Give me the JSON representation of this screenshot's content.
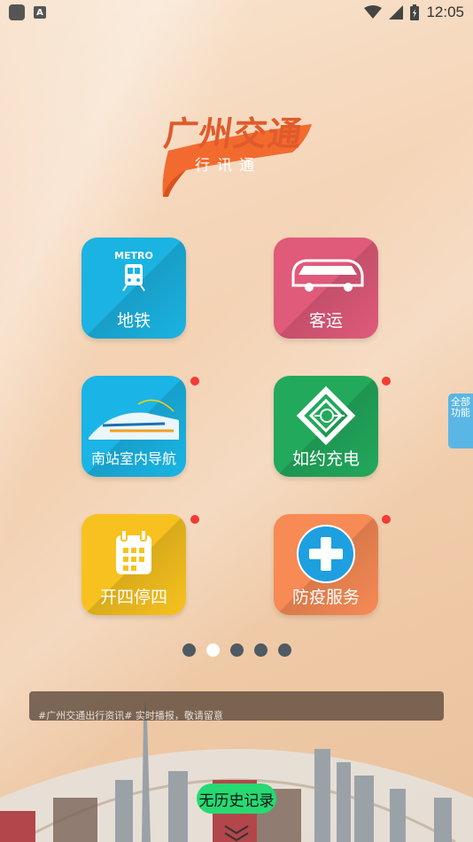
{
  "status_bar": {
    "time": "12:05",
    "left_icons": [
      "app-square-icon",
      "text-a-icon"
    ],
    "right_icons": [
      "wifi-icon",
      "signal-icon",
      "battery-icon"
    ]
  },
  "logo": {
    "title": "广州交通",
    "subtitle": "行讯通"
  },
  "apps": [
    {
      "label": "地铁",
      "icon": "metro-train-icon",
      "metro_text": "METRO",
      "color": "#1bb3e2",
      "badge": false
    },
    {
      "label": "客运",
      "icon": "bus-icon",
      "color": "#e05a7a",
      "badge": false
    },
    {
      "label": "南站室内导航",
      "icon": "high-speed-train-icon",
      "color": "#1ab5e6",
      "badge": true
    },
    {
      "label": "如约充电",
      "icon": "charging-plug-icon",
      "color": "#22a95c",
      "badge": true
    },
    {
      "label": "开四停四",
      "icon": "calendar-icon",
      "color": "#f7c21f",
      "badge": true
    },
    {
      "label": "防疫服务",
      "icon": "medical-cross-icon",
      "color": "#f78a55",
      "badge": true
    }
  ],
  "pager": {
    "count": 5,
    "active_index": 1
  },
  "side_tab": {
    "label": "全部功能"
  },
  "news": {
    "text": "#广州交通出行资讯# 实时播报，敬请留意"
  },
  "history_button": {
    "label": "无历史记录"
  },
  "colors": {
    "badge": "#f23b33",
    "history_button": "#26d973",
    "side_tab": "#5ab6e4"
  }
}
